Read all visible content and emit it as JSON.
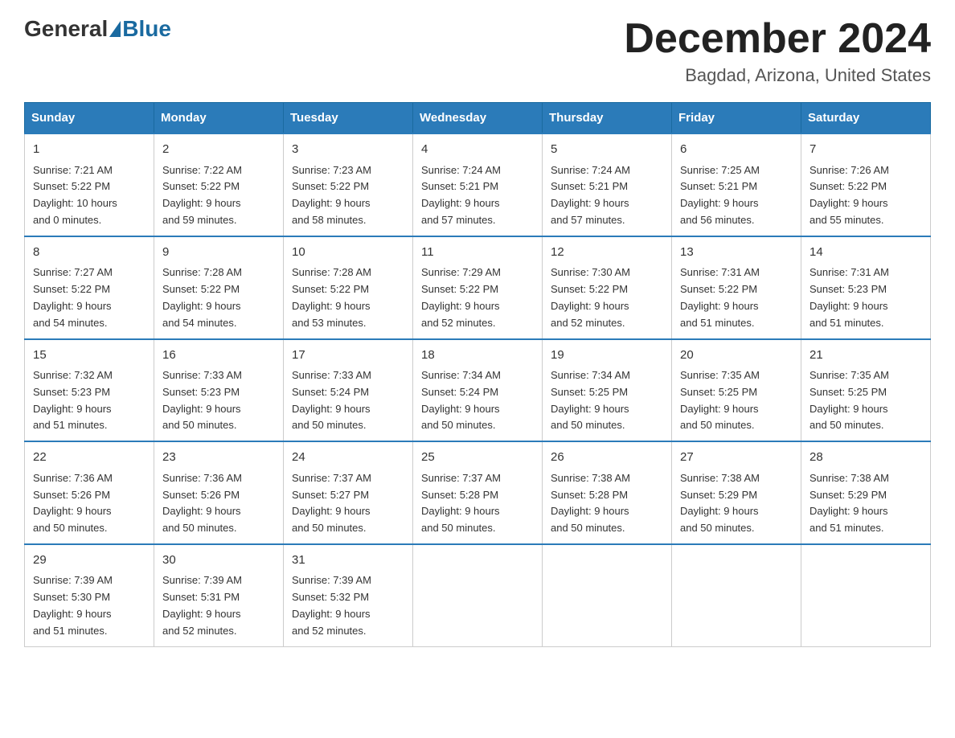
{
  "logo": {
    "general": "General",
    "blue": "Blue"
  },
  "title": "December 2024",
  "location": "Bagdad, Arizona, United States",
  "days_of_week": [
    "Sunday",
    "Monday",
    "Tuesday",
    "Wednesday",
    "Thursday",
    "Friday",
    "Saturday"
  ],
  "weeks": [
    [
      {
        "day": "1",
        "sunrise": "7:21 AM",
        "sunset": "5:22 PM",
        "daylight": "10 hours and 0 minutes."
      },
      {
        "day": "2",
        "sunrise": "7:22 AM",
        "sunset": "5:22 PM",
        "daylight": "9 hours and 59 minutes."
      },
      {
        "day": "3",
        "sunrise": "7:23 AM",
        "sunset": "5:22 PM",
        "daylight": "9 hours and 58 minutes."
      },
      {
        "day": "4",
        "sunrise": "7:24 AM",
        "sunset": "5:21 PM",
        "daylight": "9 hours and 57 minutes."
      },
      {
        "day": "5",
        "sunrise": "7:24 AM",
        "sunset": "5:21 PM",
        "daylight": "9 hours and 57 minutes."
      },
      {
        "day": "6",
        "sunrise": "7:25 AM",
        "sunset": "5:21 PM",
        "daylight": "9 hours and 56 minutes."
      },
      {
        "day": "7",
        "sunrise": "7:26 AM",
        "sunset": "5:22 PM",
        "daylight": "9 hours and 55 minutes."
      }
    ],
    [
      {
        "day": "8",
        "sunrise": "7:27 AM",
        "sunset": "5:22 PM",
        "daylight": "9 hours and 54 minutes."
      },
      {
        "day": "9",
        "sunrise": "7:28 AM",
        "sunset": "5:22 PM",
        "daylight": "9 hours and 54 minutes."
      },
      {
        "day": "10",
        "sunrise": "7:28 AM",
        "sunset": "5:22 PM",
        "daylight": "9 hours and 53 minutes."
      },
      {
        "day": "11",
        "sunrise": "7:29 AM",
        "sunset": "5:22 PM",
        "daylight": "9 hours and 52 minutes."
      },
      {
        "day": "12",
        "sunrise": "7:30 AM",
        "sunset": "5:22 PM",
        "daylight": "9 hours and 52 minutes."
      },
      {
        "day": "13",
        "sunrise": "7:31 AM",
        "sunset": "5:22 PM",
        "daylight": "9 hours and 51 minutes."
      },
      {
        "day": "14",
        "sunrise": "7:31 AM",
        "sunset": "5:23 PM",
        "daylight": "9 hours and 51 minutes."
      }
    ],
    [
      {
        "day": "15",
        "sunrise": "7:32 AM",
        "sunset": "5:23 PM",
        "daylight": "9 hours and 51 minutes."
      },
      {
        "day": "16",
        "sunrise": "7:33 AM",
        "sunset": "5:23 PM",
        "daylight": "9 hours and 50 minutes."
      },
      {
        "day": "17",
        "sunrise": "7:33 AM",
        "sunset": "5:24 PM",
        "daylight": "9 hours and 50 minutes."
      },
      {
        "day": "18",
        "sunrise": "7:34 AM",
        "sunset": "5:24 PM",
        "daylight": "9 hours and 50 minutes."
      },
      {
        "day": "19",
        "sunrise": "7:34 AM",
        "sunset": "5:25 PM",
        "daylight": "9 hours and 50 minutes."
      },
      {
        "day": "20",
        "sunrise": "7:35 AM",
        "sunset": "5:25 PM",
        "daylight": "9 hours and 50 minutes."
      },
      {
        "day": "21",
        "sunrise": "7:35 AM",
        "sunset": "5:25 PM",
        "daylight": "9 hours and 50 minutes."
      }
    ],
    [
      {
        "day": "22",
        "sunrise": "7:36 AM",
        "sunset": "5:26 PM",
        "daylight": "9 hours and 50 minutes."
      },
      {
        "day": "23",
        "sunrise": "7:36 AM",
        "sunset": "5:26 PM",
        "daylight": "9 hours and 50 minutes."
      },
      {
        "day": "24",
        "sunrise": "7:37 AM",
        "sunset": "5:27 PM",
        "daylight": "9 hours and 50 minutes."
      },
      {
        "day": "25",
        "sunrise": "7:37 AM",
        "sunset": "5:28 PM",
        "daylight": "9 hours and 50 minutes."
      },
      {
        "day": "26",
        "sunrise": "7:38 AM",
        "sunset": "5:28 PM",
        "daylight": "9 hours and 50 minutes."
      },
      {
        "day": "27",
        "sunrise": "7:38 AM",
        "sunset": "5:29 PM",
        "daylight": "9 hours and 50 minutes."
      },
      {
        "day": "28",
        "sunrise": "7:38 AM",
        "sunset": "5:29 PM",
        "daylight": "9 hours and 51 minutes."
      }
    ],
    [
      {
        "day": "29",
        "sunrise": "7:39 AM",
        "sunset": "5:30 PM",
        "daylight": "9 hours and 51 minutes."
      },
      {
        "day": "30",
        "sunrise": "7:39 AM",
        "sunset": "5:31 PM",
        "daylight": "9 hours and 52 minutes."
      },
      {
        "day": "31",
        "sunrise": "7:39 AM",
        "sunset": "5:32 PM",
        "daylight": "9 hours and 52 minutes."
      },
      null,
      null,
      null,
      null
    ]
  ],
  "labels": {
    "sunrise": "Sunrise:",
    "sunset": "Sunset:",
    "daylight": "Daylight:"
  }
}
